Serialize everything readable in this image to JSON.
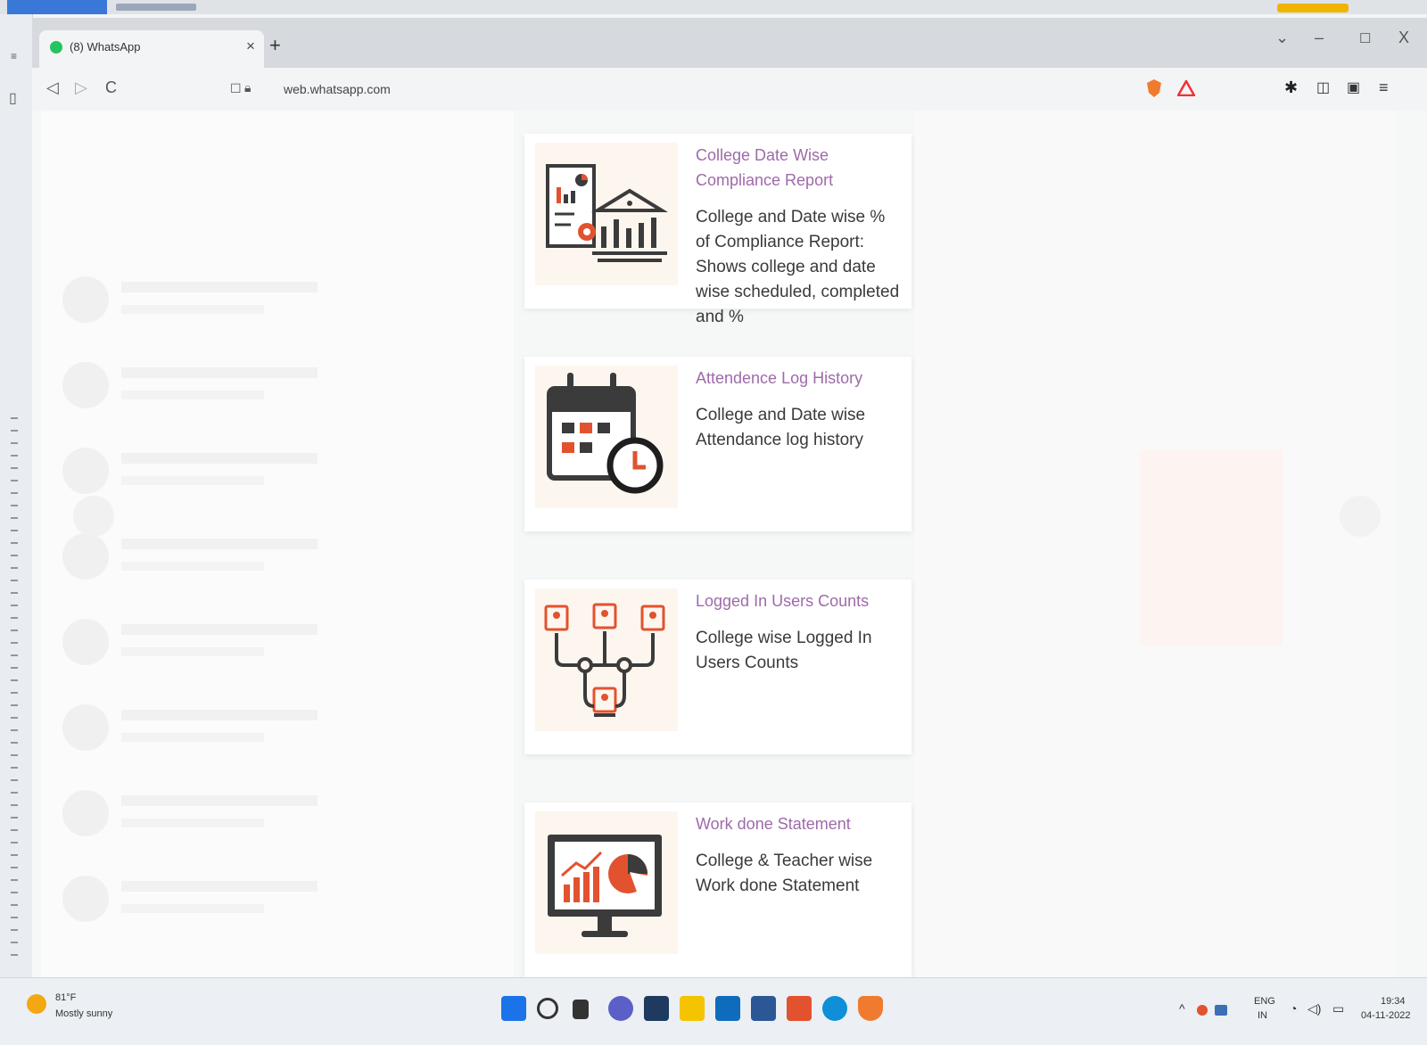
{
  "browser": {
    "tab_title": "(8) WhatsApp",
    "tab_close": "×",
    "new_tab": "+",
    "url": "web.whatsapp.com",
    "nav": {
      "back": "◁",
      "forward": "▷",
      "reload": "C",
      "bookmark": "☐"
    },
    "window_controls": {
      "menu": "⌄",
      "minimize": "–",
      "maximize": "☐",
      "close": "X"
    }
  },
  "cards": [
    {
      "title": "College Date Wise Compliance Report",
      "description": "College and Date wise % of Compliance Report: Shows college and date wise scheduled, completed and %",
      "icon": "report-building-chart-icon"
    },
    {
      "title": "Attendence Log History",
      "description": "College and Date wise Attendance log history",
      "icon": "calendar-clock-icon"
    },
    {
      "title": "Logged In Users Counts",
      "description": "College wise Logged In Users Counts",
      "icon": "users-network-icon"
    },
    {
      "title": "Work done Statement",
      "description": "College & Teacher wise Work done Statement",
      "icon": "monitor-chart-icon"
    }
  ],
  "taskbar": {
    "weather_temp": "81°F",
    "weather_condition": "Mostly sunny",
    "language": "ENG",
    "region": "IN",
    "time": "19:34",
    "date": "04-11-2022"
  },
  "colors": {
    "accent_orange": "#e2522f",
    "title_purple": "#9e6aaa",
    "dark_icon": "#3b3b3b"
  }
}
